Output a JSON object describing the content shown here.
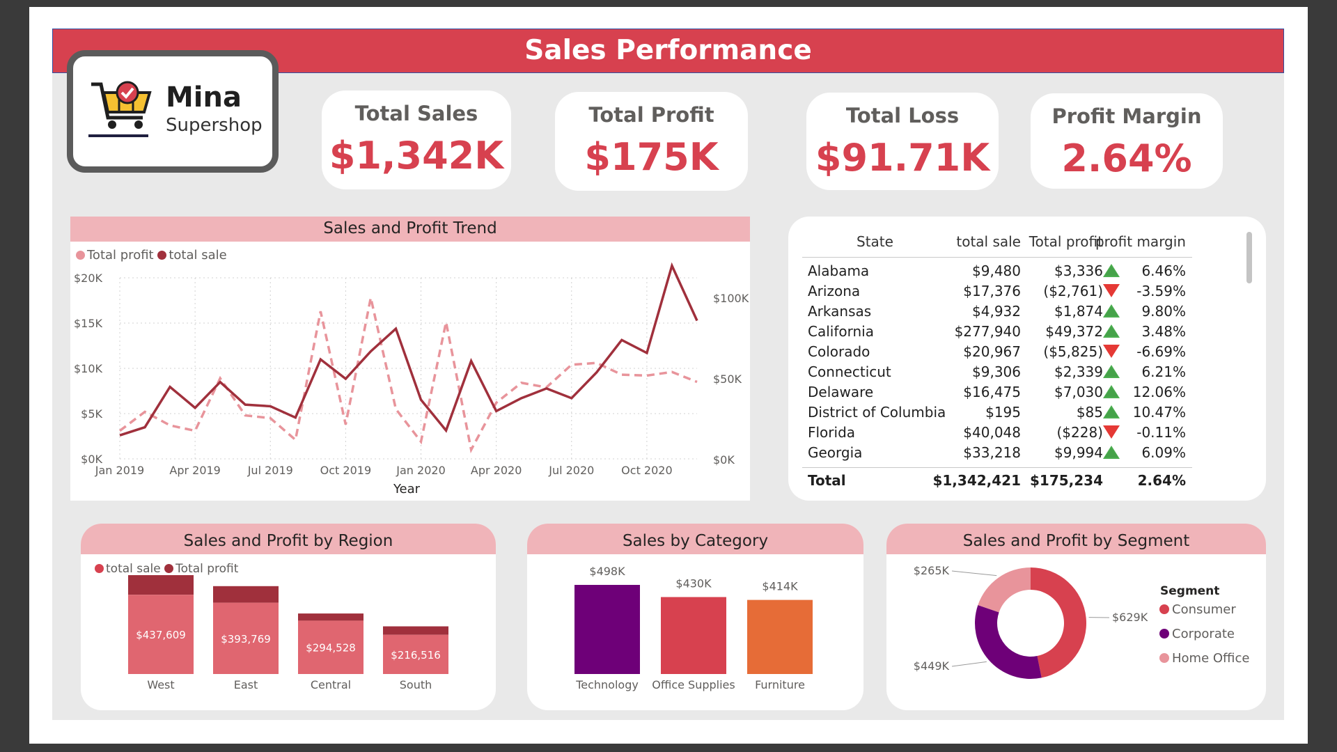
{
  "banner": {
    "title": "Sales Performance"
  },
  "logo": {
    "name": "Mina",
    "subtitle": "Supershop",
    "icon": "shopping-cart-icon"
  },
  "kpis": [
    {
      "label": "Total Sales",
      "value": "$1,342K"
    },
    {
      "label": "Total Profit",
      "value": "$175K"
    },
    {
      "label": "Total Loss",
      "value": "$91.71K"
    },
    {
      "label": "Profit Margin",
      "value": "2.64%"
    }
  ],
  "colors": {
    "accent": "#d7414f",
    "dark_red": "#a0303c",
    "light_red": "#e8949b",
    "purple": "#6e0078",
    "orange": "#e66c37",
    "title_band": "#f0b4b9",
    "canvas": "#e9e9e9"
  },
  "chart_data": [
    {
      "type": "line",
      "title": "Sales and Profit Trend",
      "xlabel": "Year",
      "x_ticks": [
        "Jan 2019",
        "Apr 2019",
        "Jul 2019",
        "Oct 2019",
        "Jan 2020",
        "Apr 2020",
        "Jul 2020",
        "Oct 2020"
      ],
      "y_left_ticks": [
        "$0K",
        "$5K",
        "$10K",
        "$15K",
        "$20K"
      ],
      "y_left_range": [
        0,
        20000
      ],
      "y_right_ticks": [
        "$0K",
        "$50K",
        "$100K"
      ],
      "y_right_range": [
        0,
        100000
      ],
      "legend": [
        "Total profit",
        "total sale"
      ],
      "legend_position": "top-left",
      "grid": true,
      "x": [
        "2019-01",
        "2019-02",
        "2019-03",
        "2019-04",
        "2019-05",
        "2019-06",
        "2019-07",
        "2019-08",
        "2019-09",
        "2019-10",
        "2019-11",
        "2019-12",
        "2020-01",
        "2020-02",
        "2020-03",
        "2020-04",
        "2020-05",
        "2020-06",
        "2020-07",
        "2020-08",
        "2020-09",
        "2020-10",
        "2020-11",
        "2020-12"
      ],
      "series": [
        {
          "name": "Total profit",
          "axis": "left",
          "style": "dashed",
          "values": [
            3100,
            5200,
            3700,
            3100,
            8900,
            4800,
            4500,
            2100,
            16300,
            3800,
            17800,
            5500,
            1900,
            15100,
            1000,
            6200,
            8400,
            7900,
            10400,
            10600,
            9300,
            9200,
            9600,
            8500
          ]
        },
        {
          "name": "total sale",
          "axis": "right",
          "style": "solid",
          "values": [
            15000,
            20000,
            45000,
            32000,
            48000,
            34000,
            33000,
            26000,
            62000,
            50000,
            67000,
            81000,
            37000,
            18000,
            61000,
            30000,
            38000,
            44000,
            38000,
            54000,
            74000,
            66000,
            120000,
            86000
          ]
        }
      ]
    },
    {
      "type": "bar",
      "title": "Sales and Profit by Region",
      "legend": [
        "total sale",
        "Total profit"
      ],
      "legend_position": "top-left",
      "categories": [
        "West",
        "East",
        "Central",
        "South"
      ],
      "series": [
        {
          "name": "total sale",
          "values": [
            437609,
            393769,
            294528,
            216516
          ],
          "labels": [
            "$437,609",
            "$393,769",
            "$294,528",
            "$216,516"
          ]
        },
        {
          "name": "Total profit",
          "values": [
            108418,
            91523,
            39706,
            46750
          ]
        }
      ]
    },
    {
      "type": "bar",
      "title": "Sales by Category",
      "categories": [
        "Technology",
        "Office Supplies",
        "Furniture"
      ],
      "values": [
        498000,
        430000,
        414000
      ],
      "labels": [
        "$498K",
        "$430K",
        "$414K"
      ],
      "colors": [
        "#6e0078",
        "#d7414f",
        "#e66c37"
      ]
    },
    {
      "type": "pie",
      "title": "Sales and Profit by Segment",
      "legend_title": "Segment",
      "legend_position": "right",
      "slices": [
        {
          "name": "Consumer",
          "value": 629000,
          "label": "$629K",
          "color": "#d7414f"
        },
        {
          "name": "Corporate",
          "value": 449000,
          "label": "$449K",
          "color": "#6e0078"
        },
        {
          "name": "Home Office",
          "value": 265000,
          "label": "$265K",
          "color": "#e8949b"
        }
      ]
    }
  ],
  "state_table": {
    "headers": [
      "State",
      "total sale",
      "Total profit",
      "profit margin"
    ],
    "rows": [
      {
        "state": "Alabama",
        "sale": "$9,480",
        "profit": "$3,336",
        "trend": "up",
        "margin": "6.46%"
      },
      {
        "state": "Arizona",
        "sale": "$17,376",
        "profit": "($2,761)",
        "trend": "down",
        "margin": "-3.59%"
      },
      {
        "state": "Arkansas",
        "sale": "$4,932",
        "profit": "$1,874",
        "trend": "up",
        "margin": "9.80%"
      },
      {
        "state": "California",
        "sale": "$277,940",
        "profit": "$49,372",
        "trend": "up",
        "margin": "3.48%"
      },
      {
        "state": "Colorado",
        "sale": "$20,967",
        "profit": "($5,825)",
        "trend": "down",
        "margin": "-6.69%"
      },
      {
        "state": "Connecticut",
        "sale": "$9,306",
        "profit": "$2,339",
        "trend": "up",
        "margin": "6.21%"
      },
      {
        "state": "Delaware",
        "sale": "$16,475",
        "profit": "$7,030",
        "trend": "up",
        "margin": "12.06%"
      },
      {
        "state": "District of Columbia",
        "sale": "$195",
        "profit": "$85",
        "trend": "up",
        "margin": "10.47%"
      },
      {
        "state": "Florida",
        "sale": "$40,048",
        "profit": "($228)",
        "trend": "down",
        "margin": "-0.11%"
      },
      {
        "state": "Georgia",
        "sale": "$33,218",
        "profit": "$9,994",
        "trend": "up",
        "margin": "6.09%"
      }
    ],
    "total": {
      "label": "Total",
      "sale": "$1,342,421",
      "profit": "$175,234",
      "margin": "2.64%"
    }
  }
}
